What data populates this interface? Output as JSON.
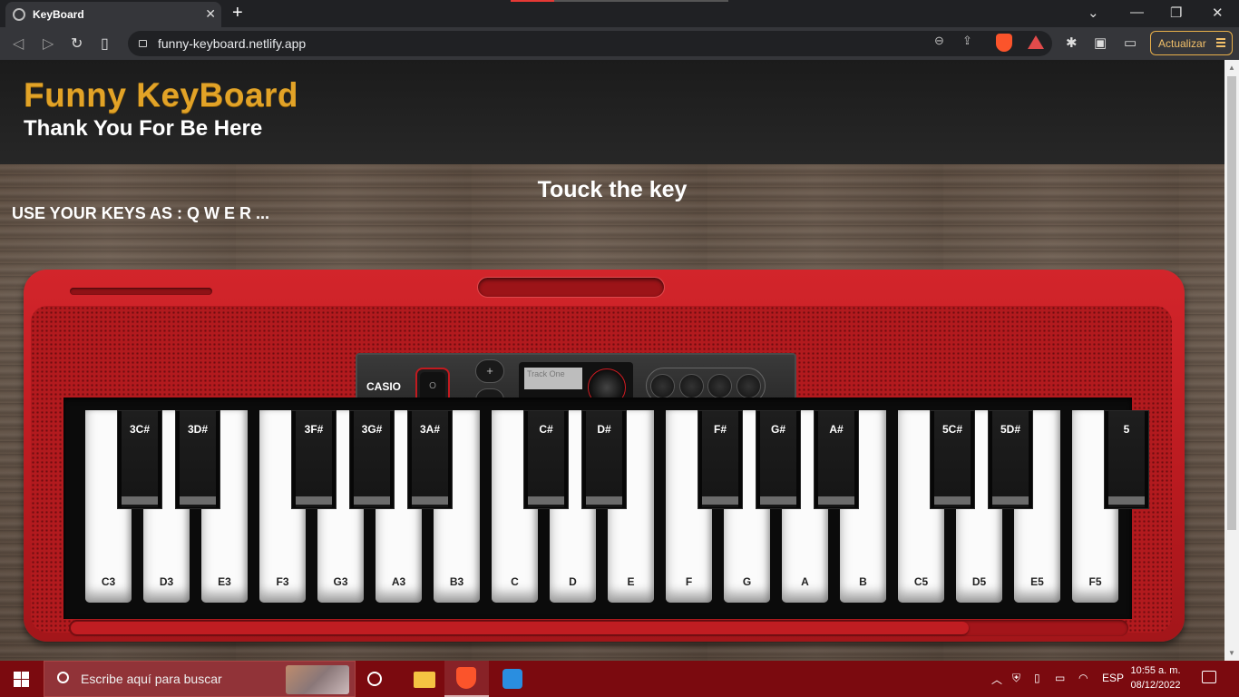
{
  "browser": {
    "tab_title": "KeyBoard",
    "tab_close": "✕",
    "new_tab": "+",
    "url": "funny-keyboard.netlify.app",
    "update_label": "Actualizar"
  },
  "page": {
    "title": "Funny KeyBoard",
    "subtitle": "Thank You For Be Here",
    "touch_heading": "Touck the key",
    "hint": "USE YOUR KEYS AS : Q W E R ..."
  },
  "panel": {
    "brand": "CASIO",
    "power_label": "O",
    "plus": "+",
    "minus": "-",
    "display_text": "Track One"
  },
  "white_keys": [
    "C3",
    "D3",
    "E3",
    "F3",
    "G3",
    "A3",
    "B3",
    "C",
    "D",
    "E",
    "F",
    "G",
    "A",
    "B",
    "C5",
    "D5",
    "E5",
    "F5"
  ],
  "black_keys": [
    "3C#",
    "3D#",
    "3F#",
    "3G#",
    "3A#",
    "C#",
    "D#",
    "F#",
    "G#",
    "A#",
    "5C#",
    "5D#",
    "5"
  ],
  "colors": {
    "title_gold": "#e2a327",
    "keyboard_red": "#c11d22",
    "taskbar": "#7b0a0f"
  },
  "taskbar": {
    "search_placeholder": "Escribe aquí para buscar",
    "language": "ESP",
    "time": "10:55 a. m.",
    "date": "08/12/2022"
  }
}
